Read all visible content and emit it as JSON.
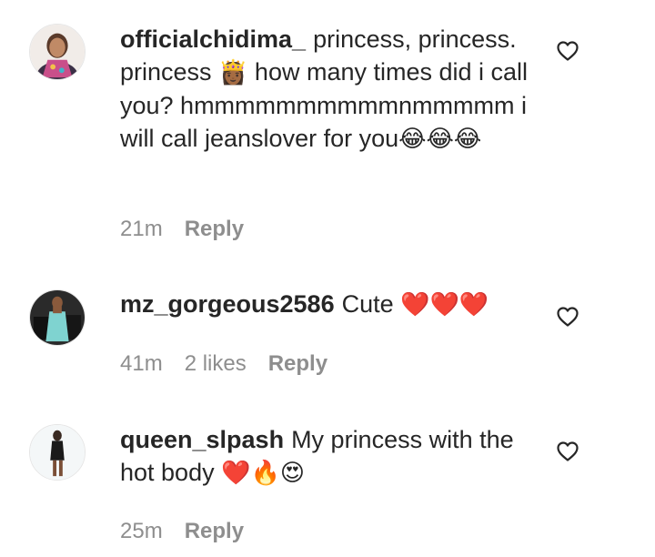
{
  "comments": [
    {
      "username": "officialchidima_",
      "text": "princess, princess. princess ",
      "emoji_1": "👸🏾",
      "text_2": " how many times did i call you? hmmmmmmmmmmnmmmmm i will call jeanslover for you",
      "emoji_2": "😂😂😂",
      "time": "21m",
      "likes": "",
      "reply": "Reply"
    },
    {
      "username": "mz_gorgeous2586",
      "text": "Cute ",
      "emoji_1": "❤️❤️❤️",
      "time": "41m",
      "likes": "2 likes",
      "reply": "Reply"
    },
    {
      "username": "queen_slpash",
      "text": "My princess with the hot body ",
      "emoji_1": "❤️🔥😍",
      "time": "25m",
      "likes": "",
      "reply": "Reply"
    }
  ],
  "icons": {
    "like": "heart-outline-icon"
  },
  "colors": {
    "text": "#262626",
    "meta": "#8e8e8e",
    "background": "#ffffff"
  }
}
